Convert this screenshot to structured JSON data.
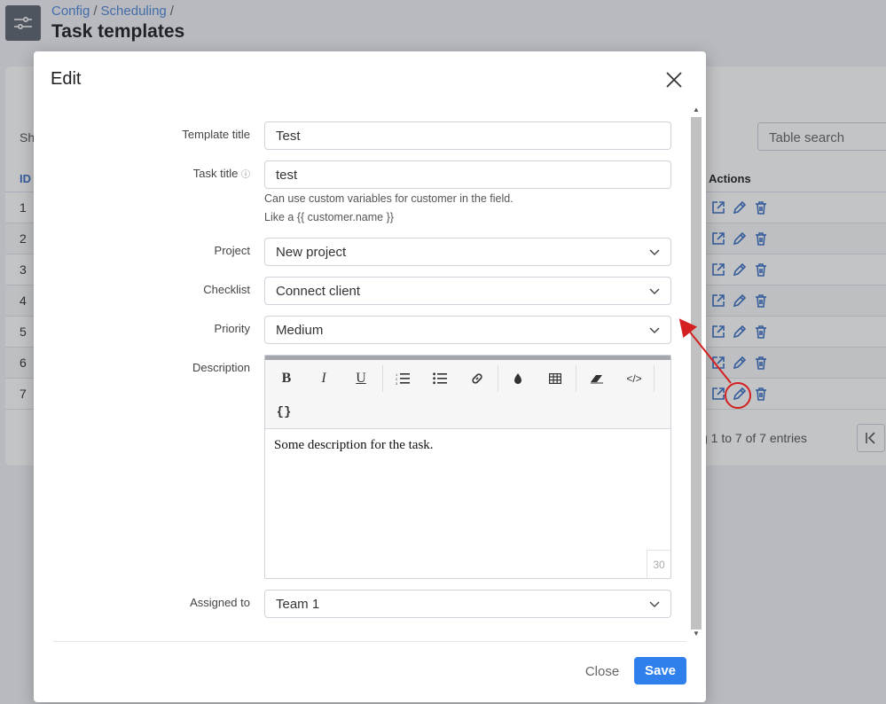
{
  "breadcrumb": {
    "config": "Config",
    "scheduling": "Scheduling",
    "sep": "/"
  },
  "page_title": "Task templates",
  "background": {
    "show_prefix": "Sh",
    "table_search_placeholder": "Table search",
    "col_id": "ID",
    "col_actions": "Actions",
    "rows": [
      "1",
      "2",
      "3",
      "4",
      "5",
      "6",
      "7"
    ],
    "entries_text": "g 1 to 7 of 7 entries"
  },
  "modal": {
    "title": "Edit",
    "labels": {
      "template_title": "Template title",
      "task_title": "Task title",
      "project": "Project",
      "checklist": "Checklist",
      "priority": "Priority",
      "description": "Description",
      "assigned_to": "Assigned to"
    },
    "values": {
      "template_title": "Test",
      "task_title": "test",
      "project": "New project",
      "checklist": "Connect client",
      "priority": "Medium",
      "assigned_to": "Team 1"
    },
    "hint_line1": "Can use custom variables for customer in the field.",
    "hint_line2": "Like a {{ customer.name }}",
    "editor": {
      "content": "Some description for the task.",
      "counter": "30",
      "toolbar": {
        "bold": "B",
        "italic": "I",
        "underline": "U",
        "vars": "{}"
      }
    },
    "buttons": {
      "close": "Close",
      "save": "Save"
    }
  },
  "colors": {
    "accent": "#2f80ed",
    "annotation": "#d42020",
    "link": "#4f86d9"
  }
}
